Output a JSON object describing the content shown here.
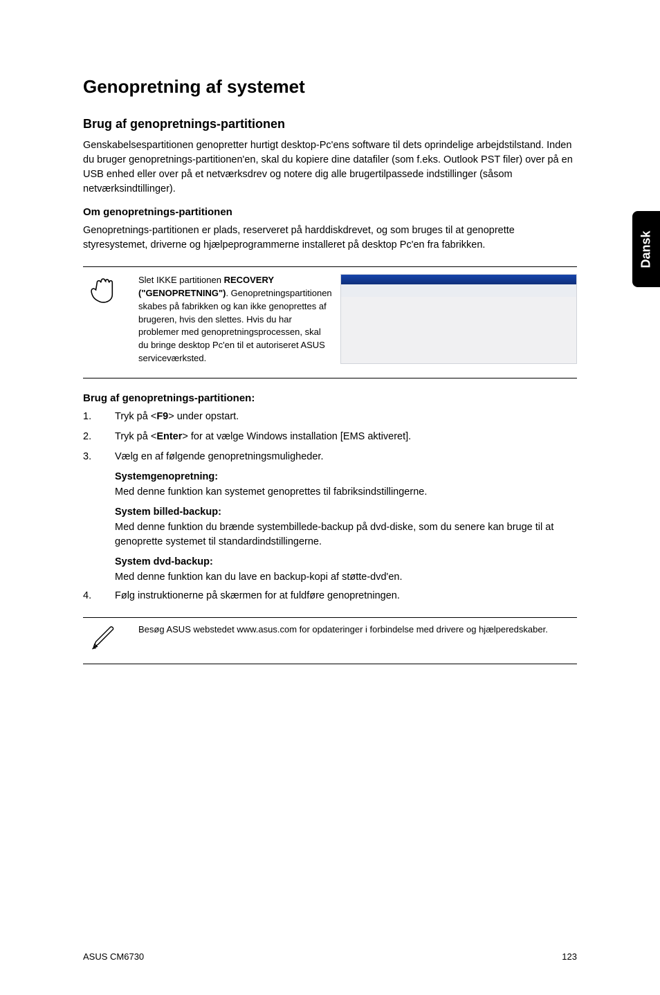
{
  "sidebar": {
    "lang": "Dansk"
  },
  "h1": "Genopretning af systemet",
  "h2a": "Brug af genopretnings-partitionen",
  "p1": "Genskabelsespartitionen genopretter hurtigt desktop-Pc'ens software til dets oprindelige arbejdstilstand. Inden du bruger genopretnings-partitionen'en, skal du kopiere dine datafiler (som f.eks. Outlook PST filer) over på en USB enhed eller over på et netværksdrev og notere dig alle brugertilpassede indstillinger (såsom netværksindtillinger).",
  "h3a": "Om genopretnings-partitionen",
  "p2": "Genopretnings-partitionen er plads, reserveret på harddiskdrevet, og som bruges til at genoprette styresystemet, driverne og hjælpeprogrammerne installeret på desktop Pc'en fra fabrikken.",
  "note1_pre": "Slet IKKE partitionen ",
  "note1_bold1": "RECOVERY (\"GENOPRETNING\")",
  "note1_post1": ". Genopretningspartitionen skabes på fabrikken og kan ikke genoprettes af brugeren, hvis den slettes. Hvis du har problemer med genopretningsprocessen, skal du bringe desktop Pc'en til et autoriseret ASUS serviceværksted.",
  "h3b": "Brug af genopretnings-partitionen:",
  "steps": [
    {
      "n": "1.",
      "pre": "Tryk på <",
      "b": "F9",
      "post": "> under opstart."
    },
    {
      "n": "2.",
      "pre": "Tryk på <",
      "b": "Enter",
      "post": "> for at vælge Windows installation [EMS aktiveret]."
    },
    {
      "n": "3.",
      "pre": "Vælg en af følgende genopretningsmuligheder.",
      "b": "",
      "post": ""
    }
  ],
  "subs": [
    {
      "head": "Systemgenopretning:",
      "body": "Med denne funktion kan systemet genoprettes til fabriksindstillingerne."
    },
    {
      "head": "System billed-backup:",
      "body": "Med denne funktion du brænde systembillede-backup på dvd-diske, som du senere kan bruge til at genoprette systemet til standardindstillingerne."
    },
    {
      "head": "System dvd-backup:",
      "body": "Med denne funktion kan du lave en backup-kopi af støtte-dvd'en."
    }
  ],
  "step4": {
    "n": "4.",
    "txt": "Følg instruktionerne på skærmen for at fuldføre genopretningen."
  },
  "note2": "Besøg ASUS webstedet www.asus.com for opdateringer i forbindelse med drivere og hjælperedskaber.",
  "footer_left": "ASUS CM6730",
  "footer_right": "123",
  "icons": {
    "hand": "hand-icon",
    "pencil": "pencil-icon"
  }
}
